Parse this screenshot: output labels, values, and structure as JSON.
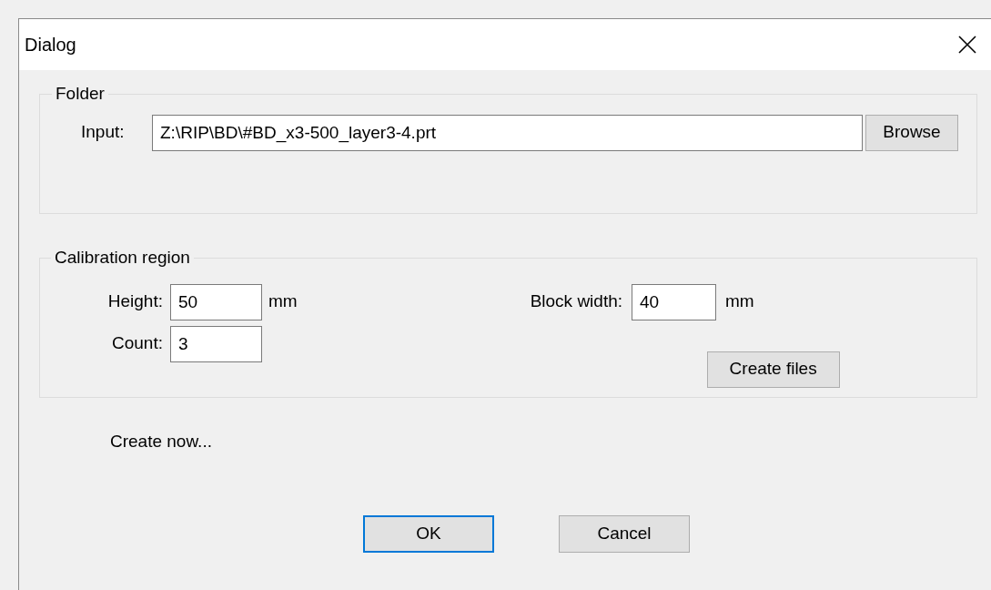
{
  "window": {
    "title": "Dialog"
  },
  "folder": {
    "title": "Folder",
    "input_label": "Input:",
    "input_value": "Z:\\RIP\\BD\\#BD_x3-500_layer3-4.prt",
    "browse_button": "Browse"
  },
  "calibration": {
    "title": "Calibration region",
    "height": {
      "label": "Height:",
      "value": "50",
      "unit": "mm"
    },
    "count": {
      "label": "Count:",
      "value": "3"
    },
    "block_width": {
      "label": "Block width:",
      "value": "40",
      "unit": "mm"
    },
    "create_button": "Create files"
  },
  "status": "Create now...",
  "buttons": [
    {
      "label": "OK",
      "default": true
    },
    {
      "label": "Cancel",
      "default": false
    }
  ]
}
